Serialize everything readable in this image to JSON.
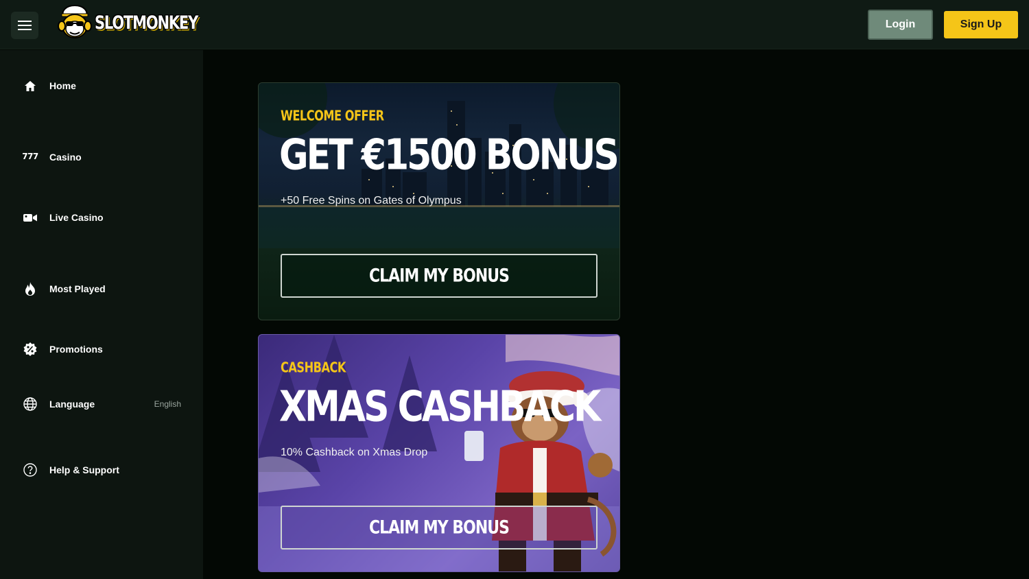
{
  "header": {
    "logo_text": "SLOTMONKEY",
    "login_label": "Login",
    "signup_label": "Sign Up"
  },
  "sidebar": {
    "items": [
      {
        "label": "Home",
        "icon": "home-icon"
      },
      {
        "label": "Casino",
        "icon": "777-icon"
      },
      {
        "label": "Live Casino",
        "icon": "video-camera-icon"
      },
      {
        "label": "Most Played",
        "icon": "flame-icon"
      },
      {
        "label": "Promotions",
        "icon": "percent-badge-icon"
      },
      {
        "label": "Language",
        "icon": "globe-icon",
        "value": "English"
      },
      {
        "label": "Help & Support",
        "icon": "question-circle-icon"
      }
    ],
    "casino_icon_text": "777"
  },
  "promos": [
    {
      "tag": "WELCOME OFFER",
      "title": "GET €1500 BONUS",
      "subtitle": "+50 Free Spins on Gates of Olympus",
      "button": "CLAIM MY BONUS"
    },
    {
      "tag": "CASHBACK",
      "title": "XMAS CASHBACK",
      "subtitle": "10% Cashback on Xmas Drop",
      "button": "CLAIM MY BONUS"
    }
  ],
  "colors": {
    "accent": "#f5c518",
    "background": "#030804",
    "sidebar": "#0d1510",
    "topbar": "#0f1a14",
    "login_button": "#6f8a7a"
  }
}
